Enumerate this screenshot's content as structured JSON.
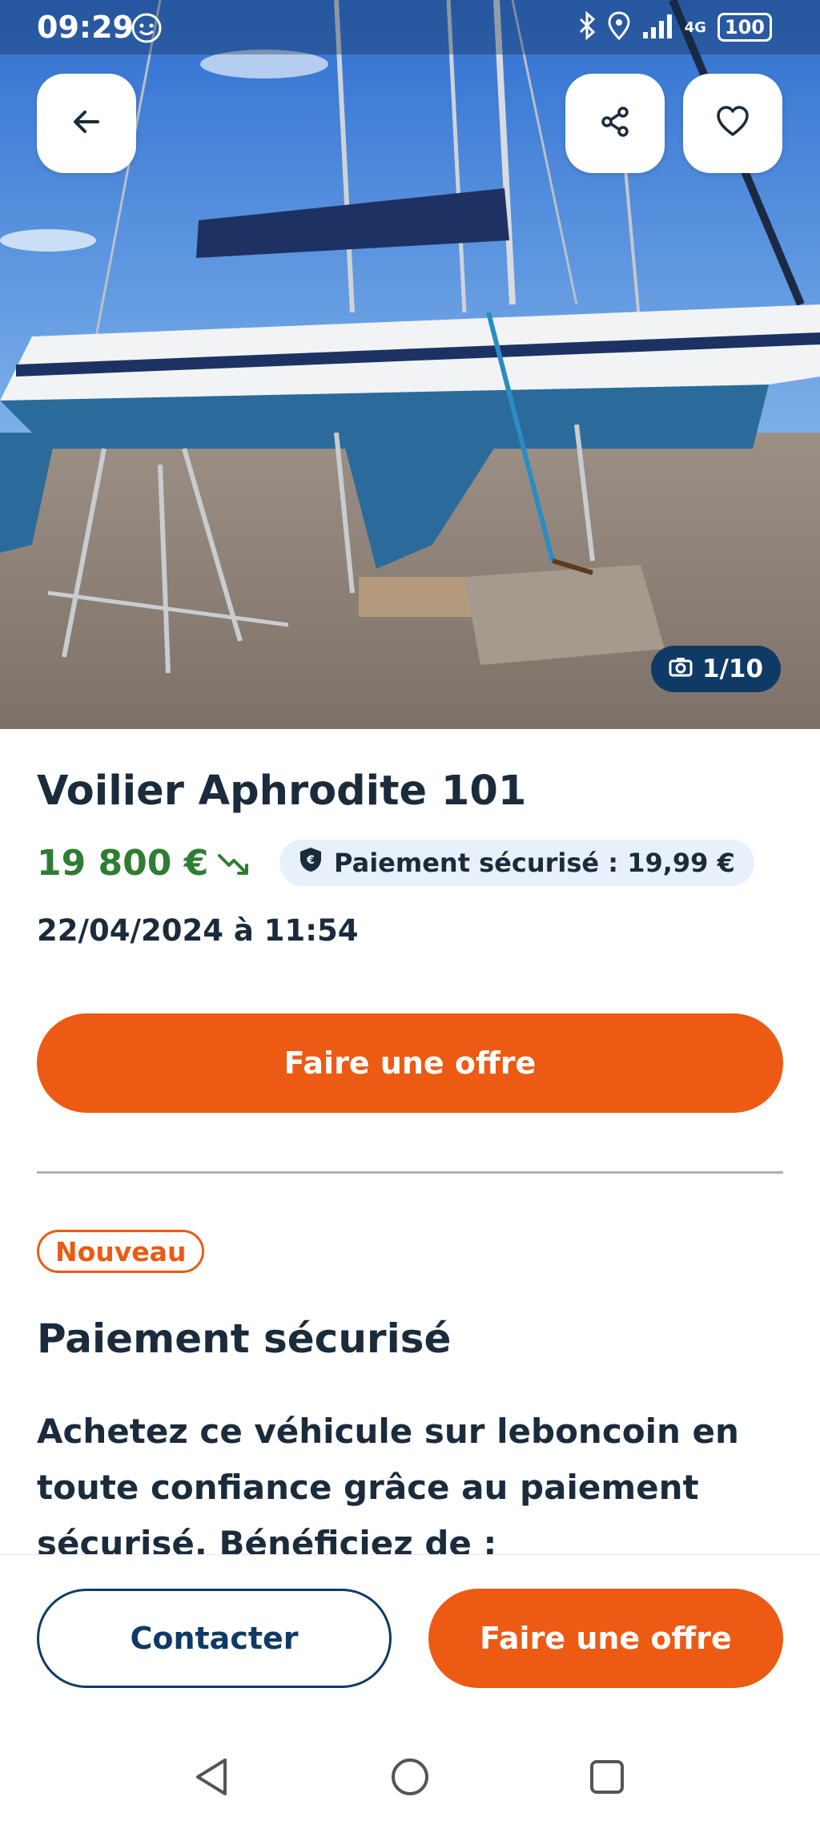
{
  "status_bar": {
    "time": "09:29",
    "network": "4G",
    "battery": "100"
  },
  "gallery": {
    "counter": "1/10"
  },
  "listing": {
    "title": "Voilier Aphrodite 101",
    "price": "19 800 €",
    "secure_payment_badge": "Paiement sécurisé : 19,99 €",
    "date": "22/04/2024 à 11:54",
    "offer_label": "Faire une offre"
  },
  "secure_section": {
    "badge": "Nouveau",
    "title": "Paiement sécurisé",
    "text": "Achetez ce véhicule sur leboncoin en toute confiance grâce au paiement sécurisé. Bénéficiez de :"
  },
  "bottom_bar": {
    "contact_label": "Contacter",
    "offer_label": "Faire une offre"
  },
  "icons": {
    "back": "arrow-left-icon",
    "share": "share-icon",
    "favorite": "heart-icon",
    "camera": "camera-icon",
    "trend": "trend-down-icon",
    "shield": "shield-euro-icon"
  },
  "colors": {
    "accent": "#ec5a13",
    "navy": "#0f3a66",
    "price_green": "#2e7d32"
  }
}
